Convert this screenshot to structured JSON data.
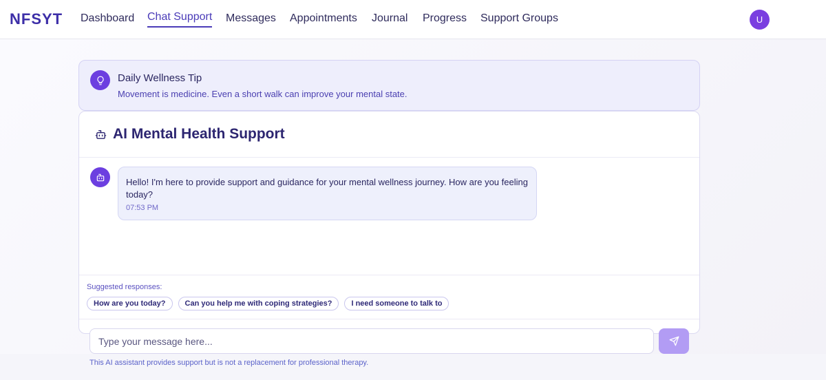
{
  "nav": {
    "logo": "NFSYT",
    "items": [
      {
        "label": "Dashboard"
      },
      {
        "label": "Chat Support"
      },
      {
        "label": "Messages"
      },
      {
        "label": "Appointments"
      },
      {
        "label": "Journal"
      },
      {
        "label": "Progress"
      },
      {
        "label": "Support Groups"
      }
    ],
    "avatar_initial": "U"
  },
  "tip": {
    "title": "Daily Wellness Tip",
    "text": "Movement is medicine. Even a short walk can improve your mental state.",
    "icon": "lightbulb-icon"
  },
  "chat": {
    "title": "AI Mental Health Support",
    "icon": "robot-icon",
    "messages": [
      {
        "sender": "bot",
        "text": "Hello! I'm here to provide support and guidance for your mental wellness journey. How are you feeling today?",
        "time": "07:53 PM"
      }
    ],
    "suggestions_label": "Suggested responses:",
    "suggestions": [
      "How are you today?",
      "Can you help me with coping strategies?",
      "I need someone to talk to"
    ],
    "input_placeholder": "Type your message here...",
    "send_icon": "send-icon"
  },
  "footer": {
    "disclaimer": "This AI assistant provides support but is not a replacement for professional therapy."
  },
  "colors": {
    "brand": "#3d2fa8",
    "accent": "#6c3fe0",
    "send": "#b29cf4"
  }
}
